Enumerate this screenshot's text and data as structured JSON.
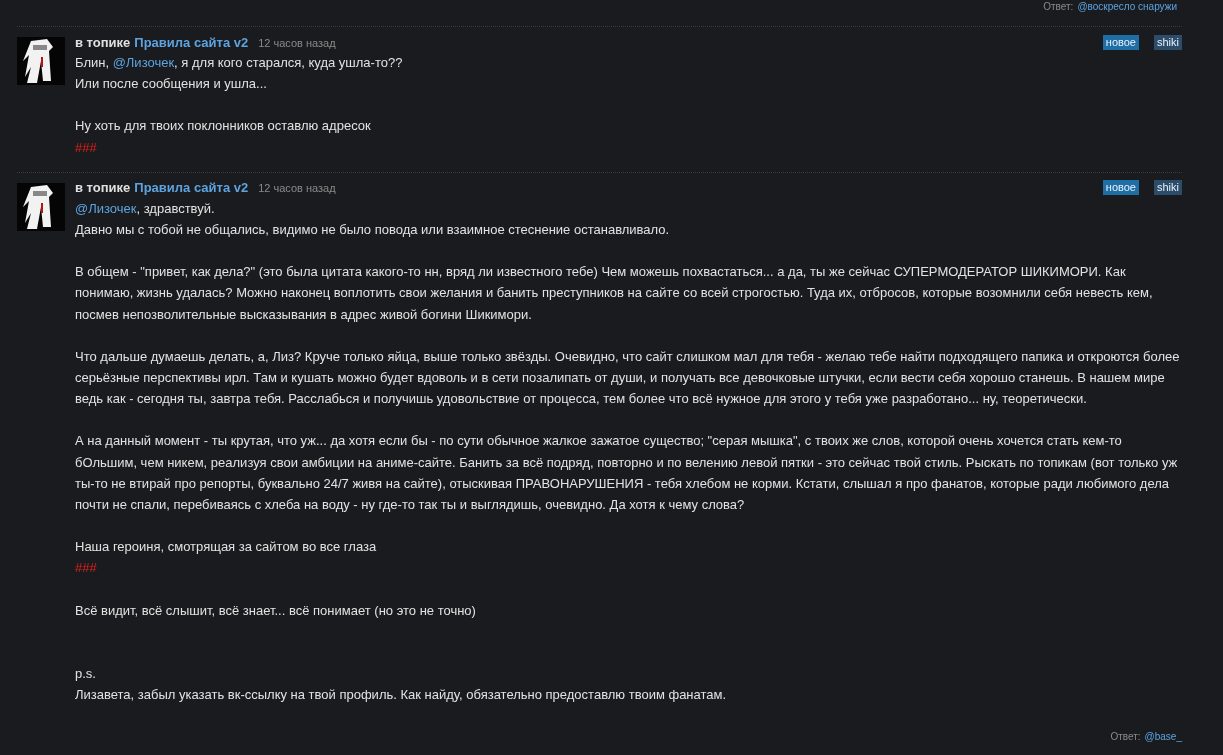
{
  "previous_reply": {
    "label": "Ответ:",
    "user": "@воскресло снаружи"
  },
  "comments": [
    {
      "topic_prefix": "в топике",
      "topic": "Правила сайта v2",
      "time": "12 часов назад",
      "badges": [
        {
          "kind": "new",
          "text": "новое"
        },
        {
          "kind": "site",
          "text": "shiki"
        }
      ],
      "paragraphs": [
        {
          "kind": "normal",
          "lines": [
            [
              {
                "kind": "text",
                "text": "Блин, "
              },
              {
                "kind": "mention",
                "text": "@Лизочек"
              },
              {
                "kind": "text",
                "text": ", я для кого старался, куда ушла-то??"
              }
            ],
            [
              {
                "kind": "text",
                "text": "Или после сообщения и ушла..."
              }
            ]
          ]
        },
        {
          "kind": "normal",
          "lines": [
            [
              {
                "kind": "text",
                "text": "Ну хоть для твоих поклонников оставлю адресок"
              }
            ],
            [
              {
                "kind": "marker",
                "text": "###"
              }
            ]
          ]
        }
      ]
    },
    {
      "topic_prefix": "в топике",
      "topic": "Правила сайта v2",
      "time": "12 часов назад",
      "badges": [
        {
          "kind": "new",
          "text": "новое"
        },
        {
          "kind": "site",
          "text": "shiki"
        }
      ],
      "paragraphs": [
        {
          "kind": "normal",
          "lines": [
            [
              {
                "kind": "mention",
                "text": "@Лизочек"
              },
              {
                "kind": "text",
                "text": ", здравствуй."
              }
            ],
            [
              {
                "kind": "text",
                "text": "Давно мы с тобой не общались, видимо не было повода или взаимное стеснение останавливало."
              }
            ]
          ]
        },
        {
          "kind": "normal",
          "lines": [
            [
              {
                "kind": "text",
                "text": "В общем - \"привет, как дела?\" (это была цитата какого-то нн, вряд ли известного тебе) Чем можешь похвастаться... а да, ты же сейчас СУПЕРМОДЕРАТОР ШИКИМОРИ. Как понимаю, жизнь удалась? Можно наконец воплотить свои желания и банить преступников на сайте со всей строгостью. Туда их, отбросов, которые возомнили себя невесть кем, посмев непозволительные высказывания в адрес живой богини Шикимори."
              }
            ]
          ]
        },
        {
          "kind": "normal",
          "lines": [
            [
              {
                "kind": "text",
                "text": "Что дальше думаешь делать, а, Лиз? Круче только яйца, выше только звёзды. Очевидно, что сайт слишком мал для тебя - желаю тебе найти подходящего папика и откроются более серьёзные перспективы ирл. Там и кушать можно будет вдоволь и в сети позалипать от души, и получать все девочковые штучки, если вести себя хорошо станешь. В нашем мире ведь как - сегодня ты, завтра тебя. Расслабься и получишь удовольствие от процесса, тем более что всё нужное для этого у тебя уже разработано... ну, теоретически."
              }
            ]
          ]
        },
        {
          "kind": "normal",
          "lines": [
            [
              {
                "kind": "text",
                "text": "А на данный момент - ты крутая, что уж... да хотя если бы - по сути обычное жалкое зажатое существо; \"серая мышка\", с твоих же слов, которой очень хочется стать кем-то бОльшим, чем никем, реализуя свои амбиции на аниме-сайте. Банить за всё подряд, повторно и по велению левой пятки - это сейчас твой стиль. Рыскать по топикам (вот только уж ты-то не втирай про репорты, буквально 24/7 живя на сайте), отыскивая ПРАВОНАРУШЕНИЯ - тебя хлебом не корми. Кстати, слышал я про фанатов, которые ради любимого дела почти не спали, перебиваясь с хлеба на воду - ну где-то так ты и выглядишь, очевидно. Да хотя к чему слова?"
              }
            ]
          ]
        },
        {
          "kind": "normal",
          "lines": [
            [
              {
                "kind": "text",
                "text": "Наша героиня, смотрящая за сайтом во все глаза"
              }
            ],
            [
              {
                "kind": "marker",
                "text": "###"
              }
            ]
          ]
        },
        {
          "kind": "normal",
          "lines": [
            [
              {
                "kind": "text",
                "text": "Всё видит, всё слышит, всё знает... всё понимает (но это не точно)"
              }
            ]
          ]
        },
        {
          "kind": "wide",
          "lines": [
            [
              {
                "kind": "text",
                "text": "p.s."
              }
            ],
            [
              {
                "kind": "text",
                "text": "Лизавета, забыл указать вк-ссылку на твой профиль. Как найду, обязательно предоставлю твоим фанатам."
              }
            ]
          ]
        }
      ],
      "reply": {
        "label": "Ответ:",
        "user": "@base_"
      }
    }
  ]
}
